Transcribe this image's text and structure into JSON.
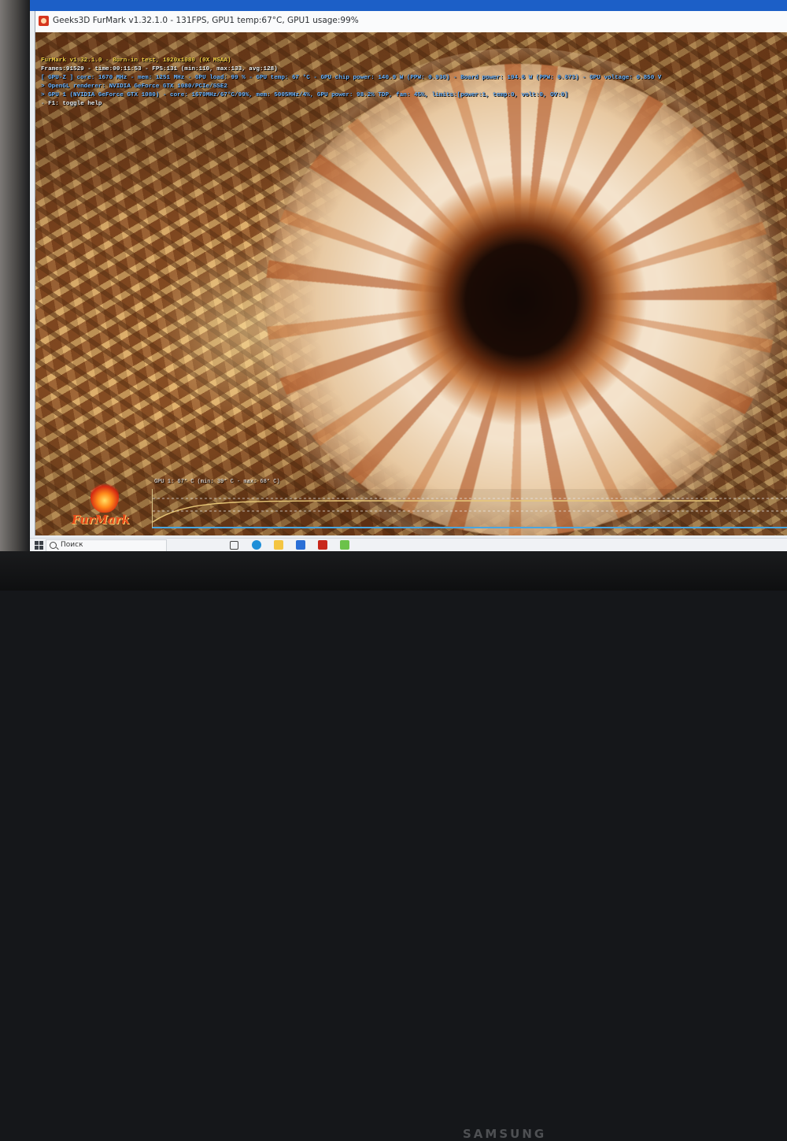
{
  "window": {
    "title": "Geeks3D FurMark v1.32.1.0 - 131FPS, GPU1 temp:67°C, GPU1 usage:99%"
  },
  "osd": {
    "lines": [
      "FurMark v1.32.1.0 - Burn-in test, 1920x1080 (0X MSAA)",
      "Frames:91529 - time:00:11:53 - FPS:131 (min:110, max:133, avg:128)",
      "[ GPU-Z ] core: 1670 MHz - mem: 1251 MHz - GPU load: 99 % - GPU temp: 67 °C - GPU chip power: 140.9 W (PPW: 0.930) - Board power: 194.6 W (PPW: 0.673) - GPU voltage: 0.850 V",
      "> OpenGL renderer: NVIDIA GeForce GTX 1080/PCIe/SSE2",
      "> GPU 1 (NVIDIA GeForce GTX 1080) - core: 1670MHz/67°C/99%, mem: 5005MHz/4%, GPU power: 98.2% TDP, fan: 45%, limits:[power:1, temp:0, volt:0, OV:0]",
      "- F1: toggle help"
    ]
  },
  "graph": {
    "label": "GPU 1: 67° C (min: 39° C - max: 68° C)",
    "current_temp": 67,
    "min_temp": 39,
    "max_temp": 68
  },
  "logo": {
    "text": "FurMark"
  },
  "taskbar": {
    "search_placeholder": "Поиск",
    "icons": [
      "task-view-icon",
      "edge-icon",
      "file-explorer-icon",
      "mail-icon",
      "furmark-icon",
      "app-icon"
    ]
  },
  "monitor": {
    "brand": "SAMSUNG"
  },
  "colors": {
    "osd_title": "#ffd84a",
    "osd_info": "#74b8ff",
    "graph_line": "#e8c878",
    "graph_axis": "#4aa6e0"
  }
}
